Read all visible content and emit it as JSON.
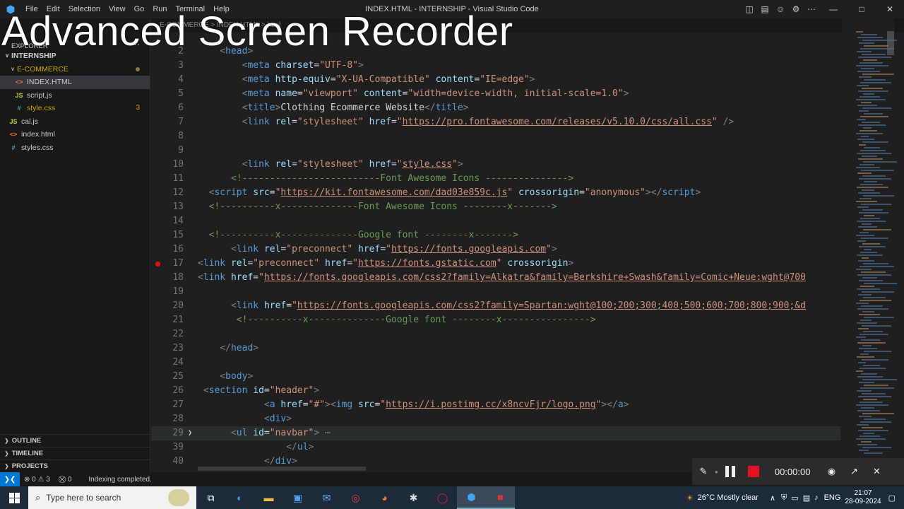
{
  "window": {
    "title": "INDEX.HTML - INTERNSHIP - Visual Studio Code",
    "menu": [
      "File",
      "Edit",
      "Selection",
      "View",
      "Go",
      "Run",
      "Terminal",
      "Help"
    ]
  },
  "watermark": "Advanced Screen Recorder",
  "explorer": {
    "header": "EXPLORER",
    "root": "INTERNSHIP",
    "folder": "E-COMMERCE",
    "folder_files": [
      {
        "name": "INDEX.HTML",
        "type": "html",
        "badge": ""
      },
      {
        "name": "script.js",
        "type": "js",
        "badge": ""
      },
      {
        "name": "style.css",
        "type": "css",
        "badge": "3"
      }
    ],
    "root_files": [
      {
        "name": "cal.js",
        "type": "js"
      },
      {
        "name": "index.html",
        "type": "html"
      },
      {
        "name": "styles.css",
        "type": "css"
      }
    ],
    "sections": [
      "OUTLINE",
      "TIMELINE",
      "PROJECTS"
    ]
  },
  "breadcrumb": "E-COMMERCE > INDEX.HTML > html",
  "code_lines": [
    {
      "n": "2",
      "indent": "    ",
      "parts": [
        [
          "p",
          "<"
        ],
        [
          "t",
          "head"
        ],
        [
          "p",
          ">"
        ]
      ]
    },
    {
      "n": "3",
      "indent": "        ",
      "parts": [
        [
          "p",
          "<"
        ],
        [
          "t",
          "meta "
        ],
        [
          "a",
          "charset"
        ],
        [
          "w",
          "="
        ],
        [
          "s",
          "\"UTF-8\""
        ],
        [
          "p",
          ">"
        ]
      ]
    },
    {
      "n": "4",
      "indent": "        ",
      "parts": [
        [
          "p",
          "<"
        ],
        [
          "t",
          "meta "
        ],
        [
          "a",
          "http-equiv"
        ],
        [
          "w",
          "="
        ],
        [
          "s",
          "\"X-UA-Compatible\" "
        ],
        [
          "a",
          "content"
        ],
        [
          "w",
          "="
        ],
        [
          "s",
          "\"IE=edge\""
        ],
        [
          "p",
          ">"
        ]
      ]
    },
    {
      "n": "5",
      "indent": "        ",
      "parts": [
        [
          "p",
          "<"
        ],
        [
          "t",
          "meta "
        ],
        [
          "a",
          "name"
        ],
        [
          "w",
          "="
        ],
        [
          "s",
          "\"viewport\" "
        ],
        [
          "a",
          "content"
        ],
        [
          "w",
          "="
        ],
        [
          "s",
          "\"width=device-width, initial-scale=1.0\""
        ],
        [
          "p",
          ">"
        ]
      ]
    },
    {
      "n": "6",
      "indent": "        ",
      "parts": [
        [
          "p",
          "<"
        ],
        [
          "t",
          "title"
        ],
        [
          "p",
          ">"
        ],
        [
          "w",
          "Clothing Ecommerce Website"
        ],
        [
          "p",
          "</"
        ],
        [
          "t",
          "title"
        ],
        [
          "p",
          ">"
        ]
      ]
    },
    {
      "n": "7",
      "indent": "        ",
      "parts": [
        [
          "p",
          "<"
        ],
        [
          "t",
          "link "
        ],
        [
          "a",
          "rel"
        ],
        [
          "w",
          "="
        ],
        [
          "s",
          "\"stylesheet\" "
        ],
        [
          "a",
          "href"
        ],
        [
          "w",
          "="
        ],
        [
          "s",
          "\""
        ],
        [
          "u",
          "https://pro.fontawesome.com/releases/v5.10.0/css/all.css"
        ],
        [
          "s",
          "\""
        ],
        [
          "p",
          " />"
        ]
      ]
    },
    {
      "n": "8",
      "indent": "",
      "parts": []
    },
    {
      "n": "9",
      "indent": "",
      "parts": []
    },
    {
      "n": "10",
      "indent": "        ",
      "parts": [
        [
          "p",
          "<"
        ],
        [
          "t",
          "link "
        ],
        [
          "a",
          "rel"
        ],
        [
          "w",
          "="
        ],
        [
          "s",
          "\"stylesheet\" "
        ],
        [
          "a",
          "href"
        ],
        [
          "w",
          "="
        ],
        [
          "s",
          "\""
        ],
        [
          "u",
          "style.css"
        ],
        [
          "s",
          "\""
        ],
        [
          "p",
          ">"
        ]
      ]
    },
    {
      "n": "11",
      "indent": "      ",
      "parts": [
        [
          "c",
          "<!-------------------------Font Awesome Icons --------------->"
        ]
      ]
    },
    {
      "n": "12",
      "indent": "  ",
      "parts": [
        [
          "p",
          "<"
        ],
        [
          "t",
          "script "
        ],
        [
          "a",
          "src"
        ],
        [
          "w",
          "="
        ],
        [
          "s",
          "\""
        ],
        [
          "u",
          "https://kit.fontawesome.com/dad03e859c.js"
        ],
        [
          "s",
          "\" "
        ],
        [
          "a",
          "crossorigin"
        ],
        [
          "w",
          "="
        ],
        [
          "s",
          "\"anonymous\""
        ],
        [
          "p",
          "></"
        ],
        [
          "t",
          "script"
        ],
        [
          "p",
          ">"
        ]
      ]
    },
    {
      "n": "13",
      "indent": "  ",
      "parts": [
        [
          "c",
          "<!----------x--------------Font Awesome Icons --------x------->"
        ]
      ]
    },
    {
      "n": "14",
      "indent": "",
      "parts": []
    },
    {
      "n": "15",
      "indent": "  ",
      "parts": [
        [
          "c",
          "<!----------x--------------Google font --------x------->"
        ]
      ]
    },
    {
      "n": "16",
      "indent": "      ",
      "parts": [
        [
          "p",
          "<"
        ],
        [
          "t",
          "link "
        ],
        [
          "a",
          "rel"
        ],
        [
          "w",
          "="
        ],
        [
          "s",
          "\"preconnect\" "
        ],
        [
          "a",
          "href"
        ],
        [
          "w",
          "="
        ],
        [
          "s",
          "\""
        ],
        [
          "u",
          "https://fonts.googleapis.com"
        ],
        [
          "s",
          "\""
        ],
        [
          "p",
          ">"
        ]
      ]
    },
    {
      "n": "17",
      "indent": "",
      "bp": true,
      "parts": [
        [
          "p",
          "<"
        ],
        [
          "t",
          "link "
        ],
        [
          "a",
          "rel"
        ],
        [
          "w",
          "="
        ],
        [
          "s",
          "\"preconnect\" "
        ],
        [
          "a",
          "href"
        ],
        [
          "w",
          "="
        ],
        [
          "s",
          "\""
        ],
        [
          "u",
          "https://fonts.gstatic.com"
        ],
        [
          "s",
          "\" "
        ],
        [
          "a",
          "crossorigin"
        ],
        [
          "p",
          ">"
        ]
      ]
    },
    {
      "n": "18",
      "indent": "",
      "parts": [
        [
          "p",
          "<"
        ],
        [
          "t",
          "link "
        ],
        [
          "a",
          "href"
        ],
        [
          "w",
          "="
        ],
        [
          "s",
          "\""
        ],
        [
          "u",
          "https://fonts.googleapis.com/css2?family=Alkatra&family=Berkshire+Swash&family=Comic+Neue:wght@700"
        ]
      ]
    },
    {
      "n": "19",
      "indent": "",
      "parts": []
    },
    {
      "n": "20",
      "indent": "      ",
      "parts": [
        [
          "p",
          "<"
        ],
        [
          "t",
          "link "
        ],
        [
          "a",
          "href"
        ],
        [
          "w",
          "="
        ],
        [
          "s",
          "\""
        ],
        [
          "u",
          "https://fonts.googleapis.com/css2?family=Spartan:wght@100;200;300;400;500;600;700;800;900;&d"
        ]
      ]
    },
    {
      "n": "21",
      "indent": "       ",
      "parts": [
        [
          "c",
          "<!----------x--------------Google font --------x---------------->"
        ]
      ]
    },
    {
      "n": "22",
      "indent": "",
      "parts": []
    },
    {
      "n": "23",
      "indent": "    ",
      "parts": [
        [
          "p",
          "</"
        ],
        [
          "t",
          "head"
        ],
        [
          "p",
          ">"
        ]
      ]
    },
    {
      "n": "24",
      "indent": "",
      "parts": []
    },
    {
      "n": "25",
      "indent": "    ",
      "parts": [
        [
          "p",
          "<"
        ],
        [
          "t",
          "body"
        ],
        [
          "p",
          ">"
        ]
      ]
    },
    {
      "n": "26",
      "indent": " ",
      "parts": [
        [
          "p",
          "<"
        ],
        [
          "t",
          "section "
        ],
        [
          "a",
          "id"
        ],
        [
          "w",
          "="
        ],
        [
          "s",
          "\"header\""
        ],
        [
          "p",
          ">"
        ]
      ]
    },
    {
      "n": "27",
      "indent": "            ",
      "parts": [
        [
          "p",
          "<"
        ],
        [
          "t",
          "a "
        ],
        [
          "a",
          "href"
        ],
        [
          "w",
          "="
        ],
        [
          "s",
          "\"#\""
        ],
        [
          "p",
          "><"
        ],
        [
          "t",
          "img "
        ],
        [
          "a",
          "src"
        ],
        [
          "w",
          "="
        ],
        [
          "s",
          "\""
        ],
        [
          "u",
          "https://i.postimg.cc/x8ncvFjr/logo.png"
        ],
        [
          "s",
          "\""
        ],
        [
          "p",
          "></"
        ],
        [
          "t",
          "a"
        ],
        [
          "p",
          ">"
        ]
      ]
    },
    {
      "n": "28",
      "indent": "            ",
      "parts": [
        [
          "p",
          "<"
        ],
        [
          "t",
          "div"
        ],
        [
          "p",
          ">"
        ]
      ]
    },
    {
      "n": "29",
      "indent": "      ",
      "fold": true,
      "hl": true,
      "parts": [
        [
          "p",
          "<"
        ],
        [
          "t",
          "ul "
        ],
        [
          "a",
          "id"
        ],
        [
          "w",
          "="
        ],
        [
          "s",
          "\"navbar\""
        ],
        [
          "p",
          ">"
        ],
        [
          "p",
          " ⋯"
        ]
      ]
    },
    {
      "n": "39",
      "indent": "                ",
      "parts": [
        [
          "p",
          "</"
        ],
        [
          "t",
          "ul"
        ],
        [
          "p",
          ">"
        ]
      ]
    },
    {
      "n": "40",
      "indent": "            ",
      "parts": [
        [
          "p",
          "</"
        ],
        [
          "t",
          "div"
        ],
        [
          "p",
          ">"
        ]
      ]
    }
  ],
  "status": {
    "errors": "0",
    "warnings": "3",
    "ports": "0",
    "message": "Indexing completed."
  },
  "recorder": {
    "time": "00:00:00"
  },
  "taskbar": {
    "search_placeholder": "Type here to search",
    "weather": "26°C  Mostly clear",
    "lang": "ENG",
    "time": "21:07",
    "date": "28-09-2024"
  }
}
